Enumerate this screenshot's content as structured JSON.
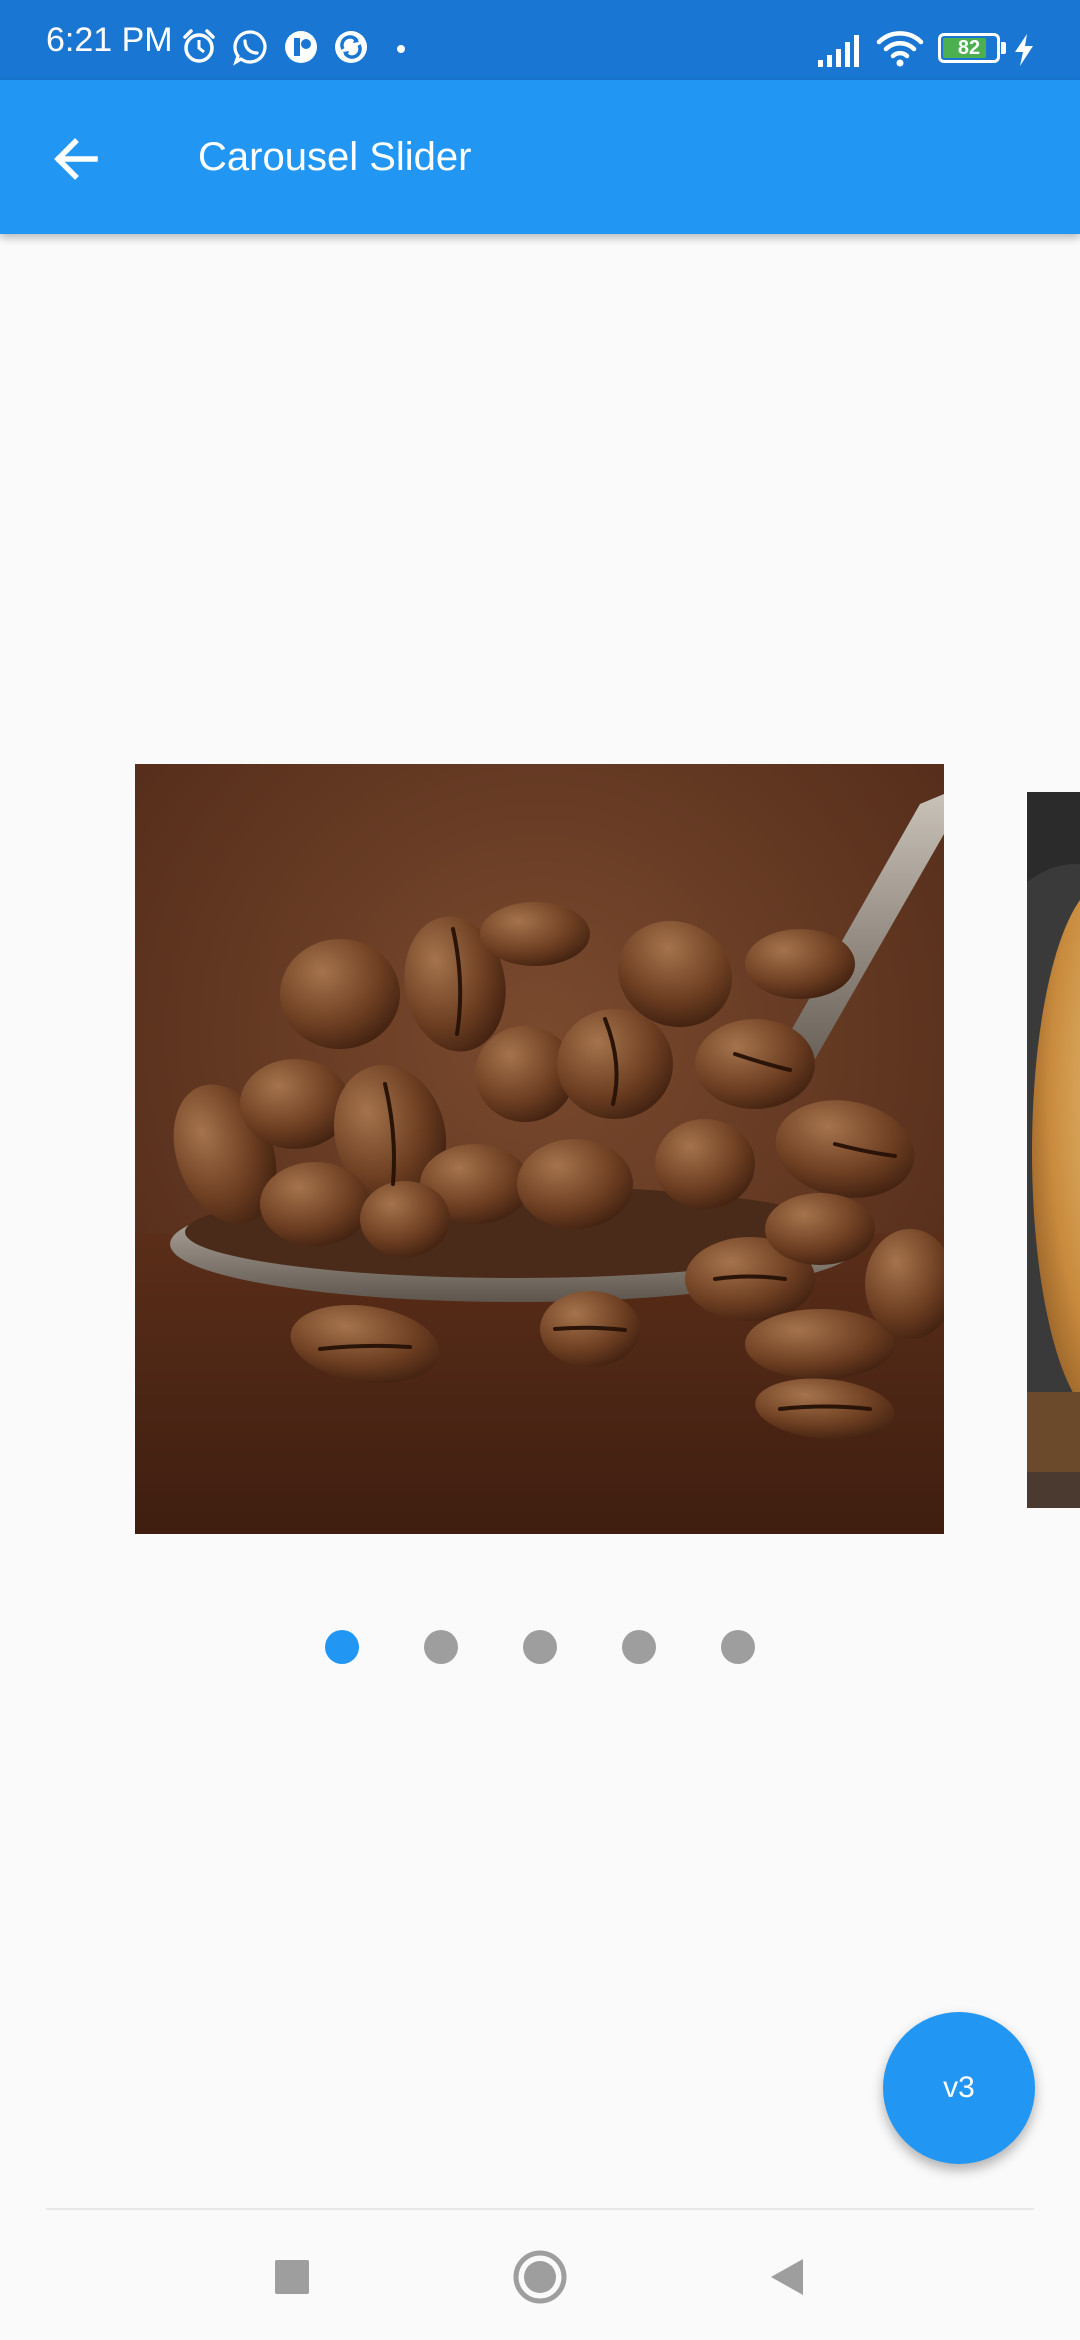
{
  "status_bar": {
    "time": "6:21 PM",
    "battery_level": "82",
    "battery_fraction": 0.82,
    "icons": [
      "alarm-icon",
      "whatsapp-icon",
      "app-notification-icon",
      "sync-icon",
      "signal-icon",
      "wifi-icon",
      "battery-icon",
      "charging-icon"
    ]
  },
  "app_bar": {
    "title": "Carousel Slider",
    "back_icon": "arrow-back-icon",
    "color": "#2196f3"
  },
  "carousel": {
    "slides": [
      {
        "subject": "coffee beans on spoon"
      },
      {
        "subject": "bread loaf"
      }
    ],
    "page_count": 5,
    "active_index": 0,
    "active_color": "#2196f3",
    "inactive_color": "#9e9e9e"
  },
  "fab": {
    "label": "v3",
    "color": "#2196f3"
  },
  "nav_bar": {
    "buttons": [
      "recents-square-icon",
      "home-circle-icon",
      "back-triangle-icon"
    ]
  }
}
